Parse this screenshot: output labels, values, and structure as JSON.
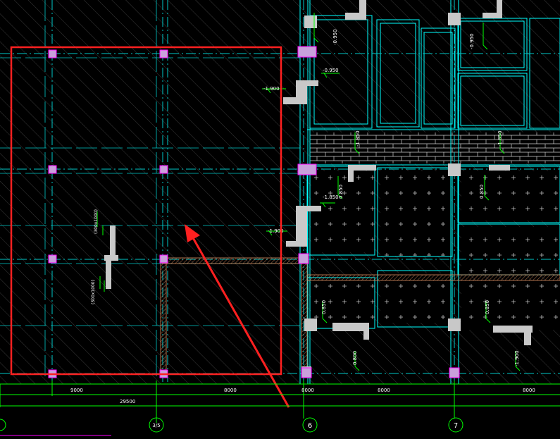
{
  "colors": {
    "background": "#000000",
    "hatch": "#3a3a3a",
    "axis": "#00c8c8",
    "wall": "#00ffff",
    "column_fill": "#c9a0dc",
    "column_stroke": "#ff00ff",
    "dim": "#00ff00",
    "selection": "#ff2020",
    "beam": "#d98c5f",
    "slab_fill": "#000000",
    "brick": "#cfcfcf"
  },
  "elevation_labels": [
    {
      "id": "lv1",
      "text": "-0.950"
    },
    {
      "id": "lv2",
      "text": "-0.950"
    },
    {
      "id": "lv3",
      "text": "-0.950"
    },
    {
      "id": "lv4",
      "text": "-1.900"
    },
    {
      "id": "lv5",
      "text": "-1.900"
    },
    {
      "id": "lv6",
      "text": "-1.900"
    },
    {
      "id": "lv7",
      "text": "-1.850"
    },
    {
      "id": "lv8",
      "text": "-1.850"
    },
    {
      "id": "lv9",
      "text": "-1.850"
    },
    {
      "id": "lv10",
      "text": "0.850"
    },
    {
      "id": "lv11",
      "text": "0.850"
    },
    {
      "id": "lv12",
      "text": "0.850"
    },
    {
      "id": "lv13",
      "text": "0.850"
    },
    {
      "id": "lv14",
      "text": "0.800"
    },
    {
      "id": "lv15",
      "text": "-1.900"
    }
  ],
  "beam_labels": [
    {
      "id": "b1",
      "text": "(300x1000)"
    },
    {
      "id": "b2",
      "text": "(300x1000)"
    }
  ],
  "dimensions": {
    "row1": [
      "9000",
      "8000",
      "8000",
      "8000",
      "8000"
    ],
    "total": "29500"
  },
  "axis_bubbles": [
    "3/5",
    "6",
    "7"
  ]
}
